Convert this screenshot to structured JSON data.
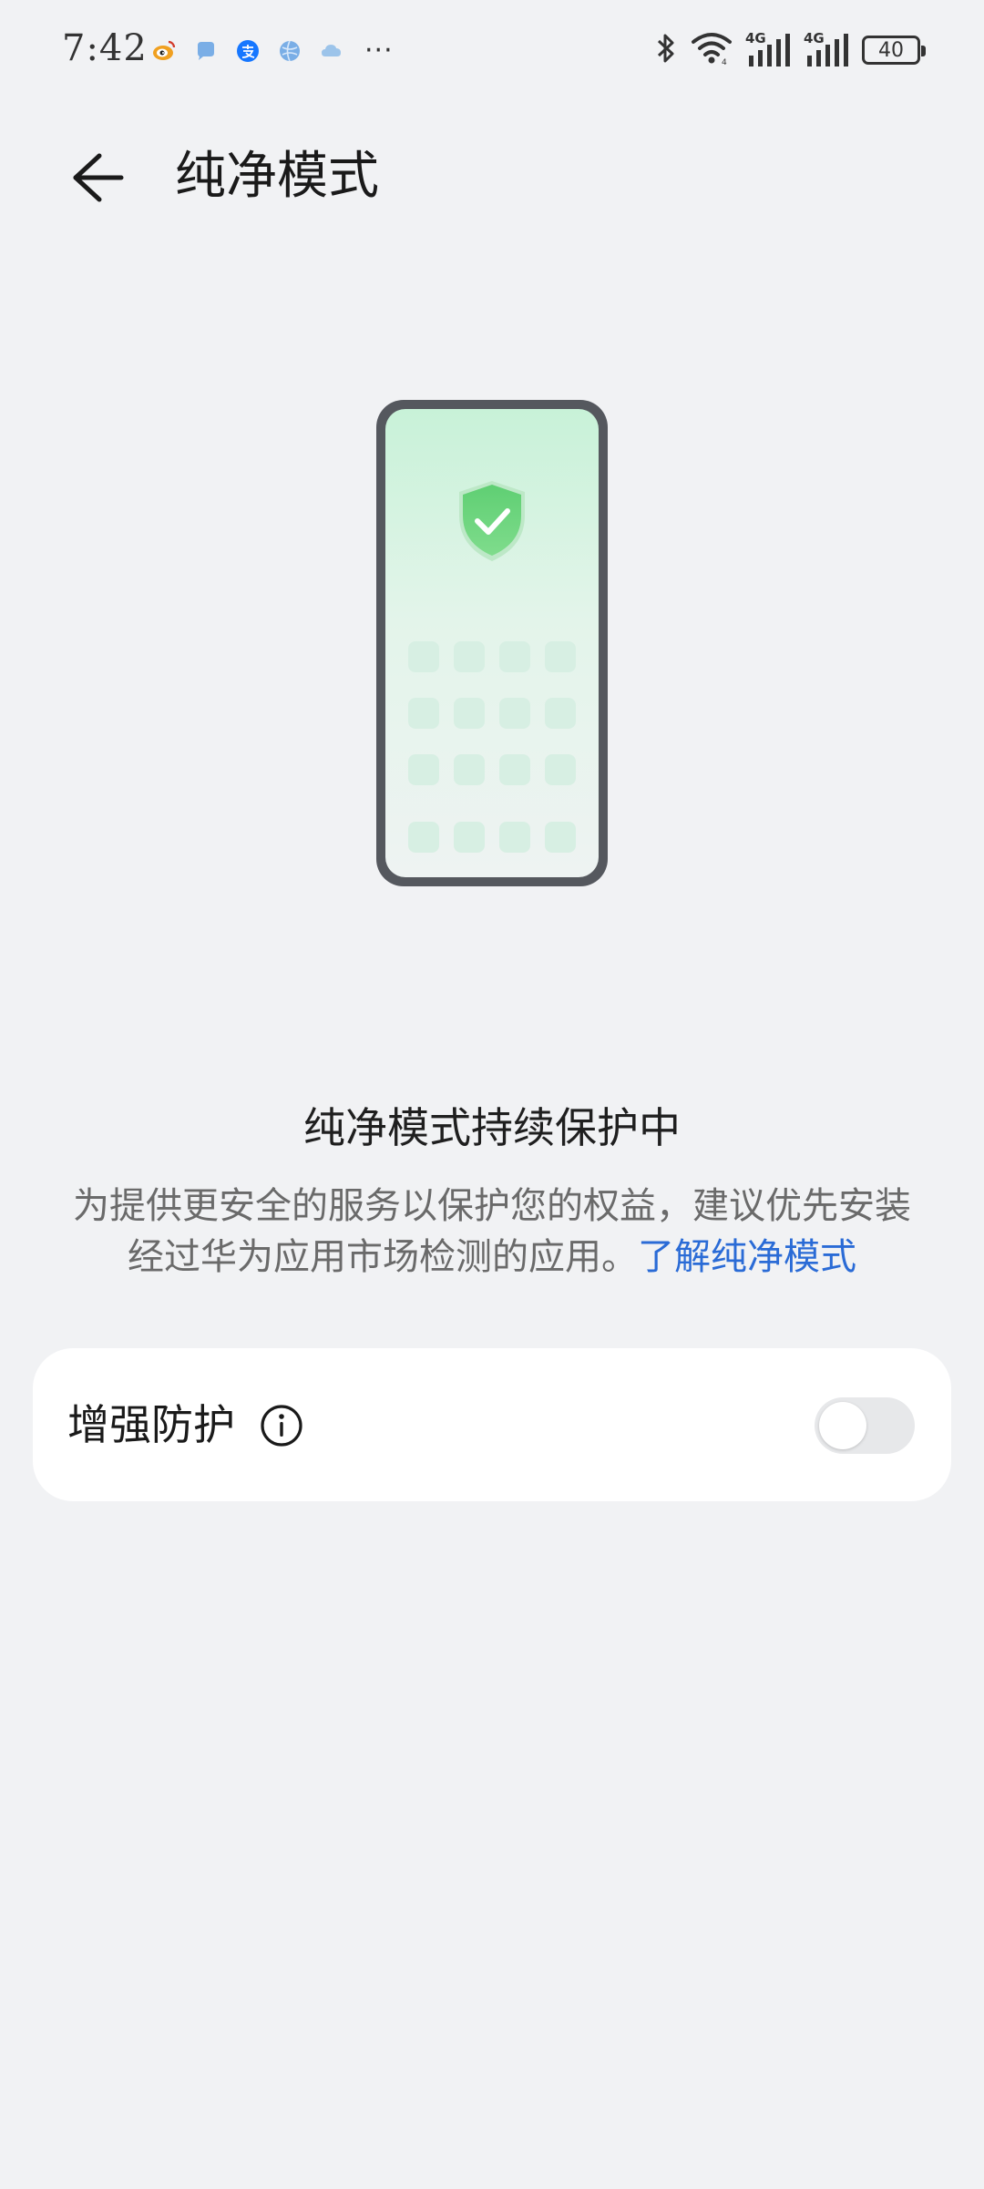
{
  "status_bar": {
    "time": "7:42",
    "notification_icons": [
      "weibo-icon",
      "chat-icon",
      "alipay-icon",
      "browser-icon",
      "cloud-icon"
    ],
    "more_indicator": "···",
    "system_icons": [
      "bluetooth-icon",
      "wifi-icon",
      "signal-4g-icon",
      "signal-4g-icon"
    ],
    "network_label_1": "4G",
    "network_label_2": "4G",
    "battery_level": "40"
  },
  "header": {
    "title": "纯净模式",
    "back_icon": "back-arrow-icon"
  },
  "illustration": {
    "icon": "shield-check-icon",
    "accent_color": "#6fd37f"
  },
  "status": {
    "title": "纯净模式持续保护中",
    "description": "为提供更安全的服务以保护您的权益，建议优先安装经过华为应用市场检测的应用。",
    "link_text": "了解纯净模式",
    "link_color": "#2a6bd6"
  },
  "enhanced_protection": {
    "label": "增强防护",
    "info_icon": "info-icon",
    "toggle_on": false
  }
}
